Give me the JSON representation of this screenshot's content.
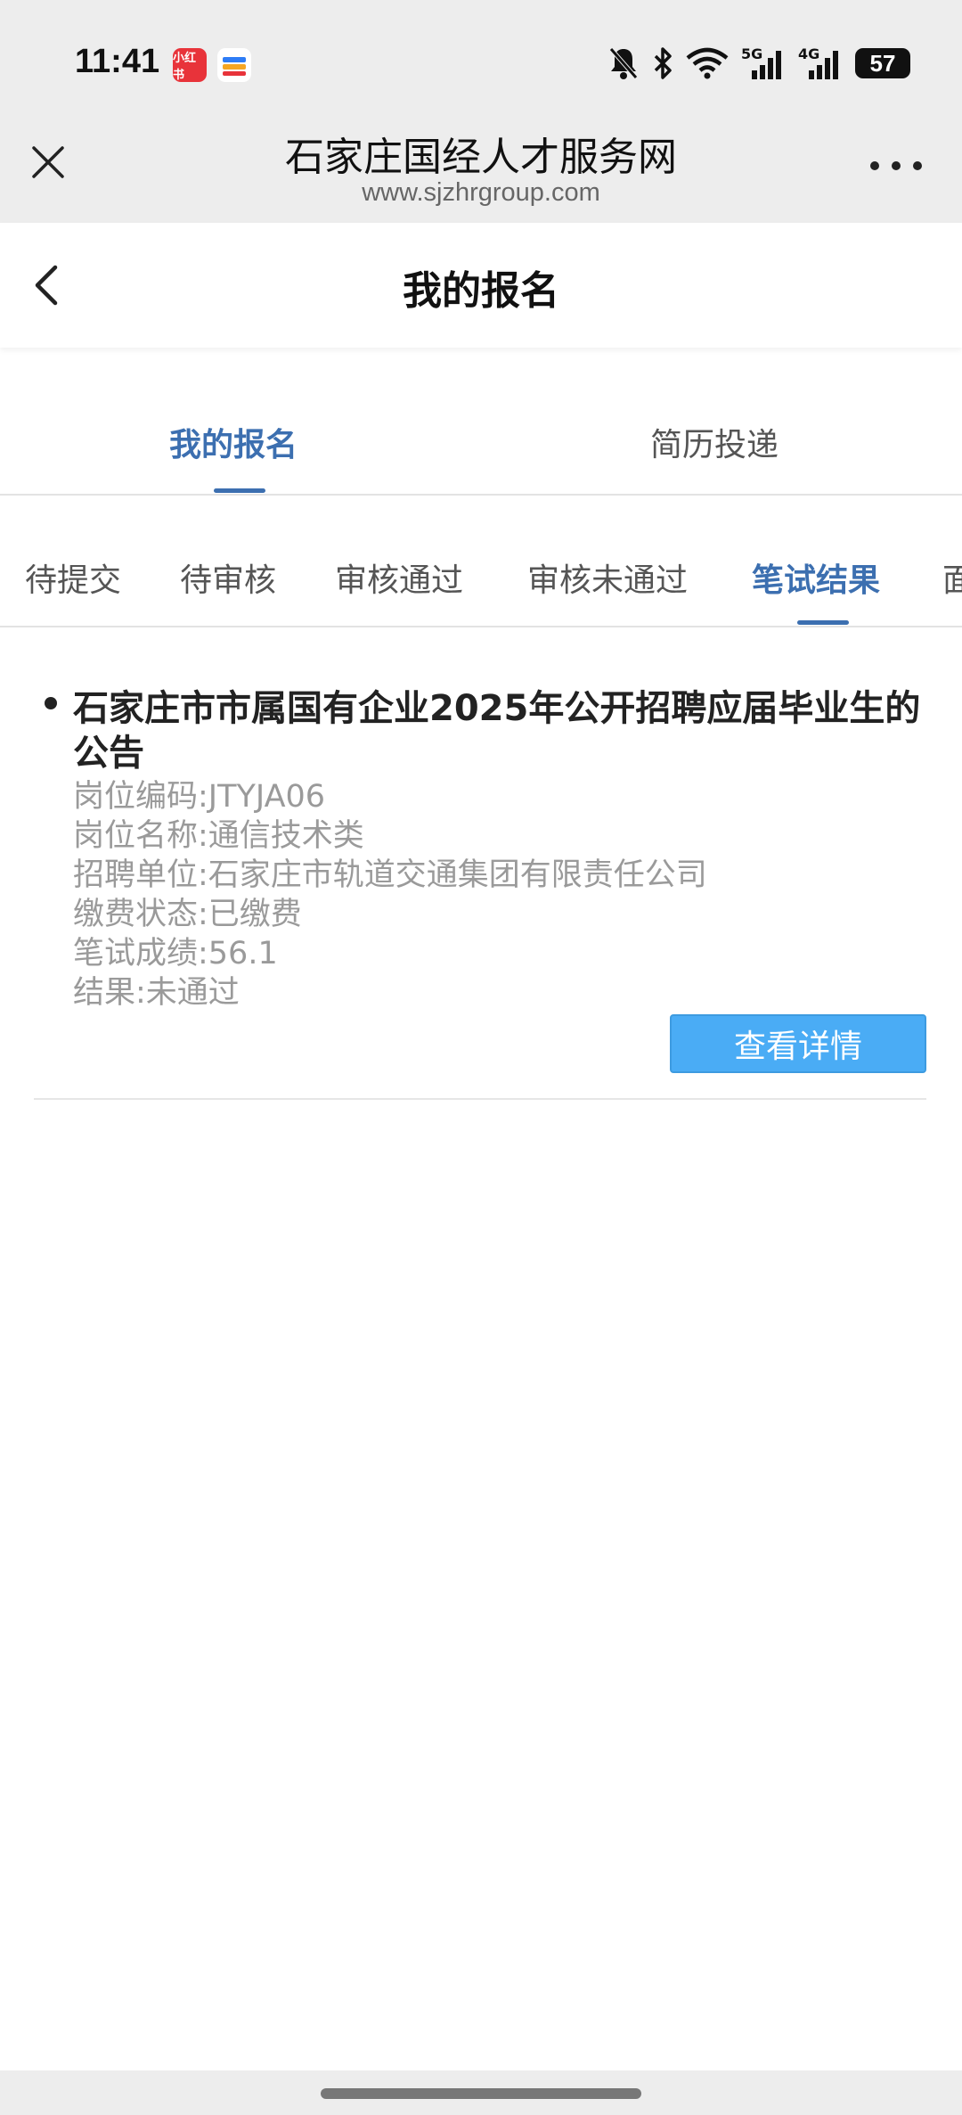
{
  "status_bar": {
    "time": "11:41",
    "app1_label": "小红书",
    "network_5g": "5G",
    "network_4g": "4G",
    "battery": "57",
    "icons": [
      "mute-icon",
      "bluetooth-icon",
      "wifi-icon",
      "signal-5g-icon",
      "signal-4g-icon",
      "battery-icon"
    ]
  },
  "browser": {
    "title": "石家庄国经人才服务网",
    "url": "www.sjzhrgroup.com"
  },
  "header": {
    "title": "我的报名"
  },
  "main_tabs": [
    {
      "label": "我的报名",
      "active": true
    },
    {
      "label": "简历投递",
      "active": false
    }
  ],
  "sub_tabs": [
    {
      "label": "待提交",
      "active": false
    },
    {
      "label": "待审核",
      "active": false
    },
    {
      "label": "审核通过",
      "active": false
    },
    {
      "label": "审核未通过",
      "active": false
    },
    {
      "label": "笔试结果",
      "active": true
    },
    {
      "label": "面",
      "active": false
    }
  ],
  "record": {
    "title": "石家庄市市属国有企业2025年公开招聘应届毕业生的公告",
    "lines": [
      "岗位编码:JTYJA06",
      "岗位名称:通信技术类",
      "招聘单位:石家庄市轨道交通集团有限责任公司",
      "缴费状态:已缴费",
      "笔试成绩:56.1",
      "结果:未通过"
    ],
    "detail_button": "查看详情"
  },
  "colors": {
    "accent": "#3c6fb0",
    "button": "#4aacf5",
    "muted_text": "#9a9a9a"
  }
}
